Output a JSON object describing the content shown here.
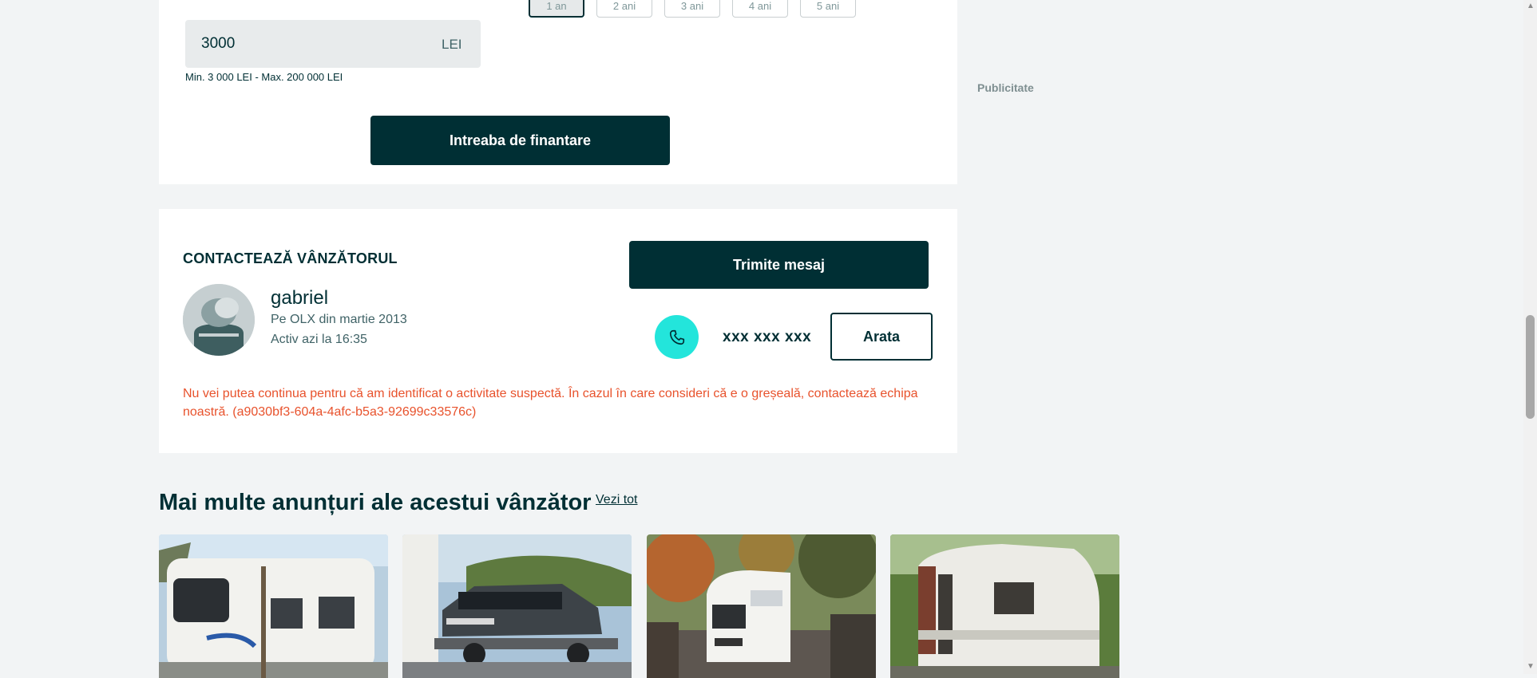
{
  "financing": {
    "terms": [
      {
        "label": "1 an",
        "selected": true
      },
      {
        "label": "2 ani",
        "selected": false
      },
      {
        "label": "3 ani",
        "selected": false
      },
      {
        "label": "4 ani",
        "selected": false
      },
      {
        "label": "5 ani",
        "selected": false
      }
    ],
    "amount_value": "3000",
    "amount_currency": "LEI",
    "amount_hint": "Min. 3 000 LEI - Max. 200 000 LEI",
    "ask_button": "Intreaba de finantare"
  },
  "advertising_label": "Publicitate",
  "contact": {
    "title": "CONTACTEAZĂ VÂNZĂTORUL",
    "seller_name": "gabriel",
    "seller_since": "Pe OLX din martie 2013",
    "seller_active": "Activ azi la 16:35",
    "send_message_button": "Trimite mesaj",
    "phone_masked": "xxx xxx xxx",
    "show_phone_button": "Arata",
    "error_message": "Nu vei putea continua pentru că am identificat o activitate suspectă. În cazul în care consideri că e o greșeală, contactează echipa noastră. (a9030bf3-604a-4afc-b5a3-92699c33576c)"
  },
  "more_ads": {
    "title": "Mai multe anunțuri ale acestui vânzător",
    "see_all": "Vezi tot"
  },
  "icons": {
    "phone": "phone-icon",
    "avatar": "user-avatar-icon"
  },
  "colors": {
    "primary_dark": "#002f34",
    "accent_teal": "#23e5db",
    "error": "#e8522c",
    "page_background": "#f2f4f5"
  }
}
